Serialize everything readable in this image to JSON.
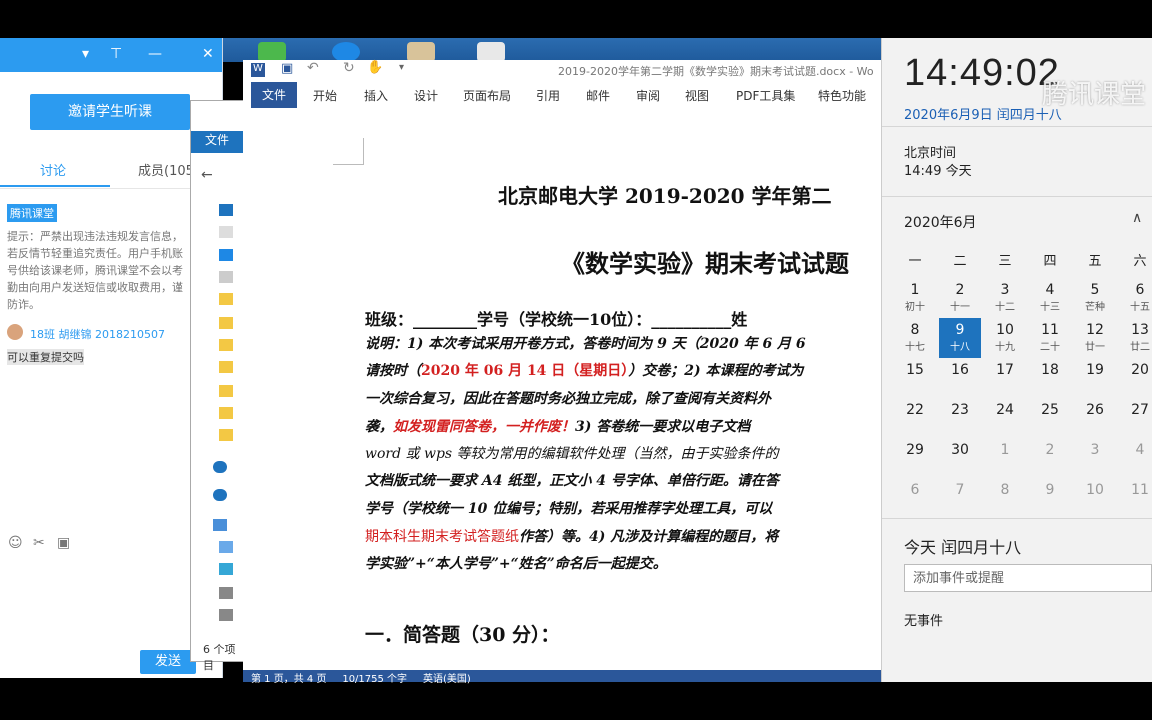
{
  "tencent": {
    "invite_button": "邀请学生听课",
    "tab_discuss": "讨论",
    "tab_members": "成员(105",
    "brand_badge": "腾讯课堂",
    "notice": "提示：严禁出现违法违规发言信息，若反情节轻重追究责任。用户手机账号供给该课老师，腾讯课堂不会以考勤由向用户发送短信或收取费用，谨防诈。",
    "message_user": "18班 胡继锦 2018210507",
    "message_text": "可以重复提交吗",
    "send_button": "发送"
  },
  "explorer": {
    "file_tab": "文件",
    "item_count": "6 个项目"
  },
  "word": {
    "title": "2019-2020学年第二学期《数学实验》期末考试试题.docx - Wo",
    "tabs": [
      "文件",
      "开始",
      "插入",
      "设计",
      "页面布局",
      "引用",
      "邮件",
      "审阅",
      "视图",
      "PDF工具集",
      "特色功能"
    ],
    "status": "第 1 页，共 4 页     10/1755 个字     英语(美国)",
    "doc": {
      "heading1": "北京邮电大学 2019-2020 学年第二",
      "heading2": "《数学实验》期末考试试题",
      "class_line": "班级：________学号（学校统一10位）：__________姓",
      "line1": "说明：1) 本次考试采用开卷方式，答卷时间为 9 天（2020 年 6 月 6",
      "line2a": "请按时（",
      "line2_red": "2020 年 06 月 14 日（星期日）",
      "line2b": "）交卷；2) 本课程的考试为",
      "line3": "一次综合复习，因此在答题时务必独立完成，除了查阅有关资料外",
      "line4a": "袭，",
      "line4_red": "如发现雷同答卷，一并作废！",
      "line4b": "3) 答卷统一要求以电子文档",
      "line5": "word 或 wps 等较为常用的编辑软件处理（当然，由于实验条件的",
      "line6": "文档版式统一要求 A4 纸型，正文小 4 号字体、单倍行距。请在答",
      "line7": "学号（学校统一 10 位编号；特别，若采用推荐字处理工具，可以",
      "line8_red": "期本科生期末考试答题纸",
      "line8b": "作答）等。4) 凡涉及计算编程的题目，将",
      "line9": "学实验”+“本人学号”+“姓名”命名后一起提交。",
      "section1": "一．简答题（30 分）："
    }
  },
  "calendar": {
    "clock": "14:49:02",
    "watermark": "腾讯课堂",
    "date_line": "2020年6月9日 闰四月十八",
    "zone_label": "北京时间",
    "zone_time": "14:49 今天",
    "month": "2020年6月",
    "weekdays": [
      "一",
      "二",
      "三",
      "四",
      "五",
      "六"
    ],
    "rows": [
      [
        [
          "1",
          "初十"
        ],
        [
          "2",
          "十一"
        ],
        [
          "3",
          "十二"
        ],
        [
          "4",
          "十三"
        ],
        [
          "5",
          "芒种"
        ],
        [
          "6",
          "十五"
        ]
      ],
      [
        [
          "8",
          "十七"
        ],
        [
          "9",
          "十八"
        ],
        [
          "10",
          "十九"
        ],
        [
          "11",
          "二十"
        ],
        [
          "12",
          "廿一"
        ],
        [
          "13",
          "廿二"
        ]
      ],
      [
        [
          "15",
          ""
        ],
        [
          "16",
          ""
        ],
        [
          "17",
          ""
        ],
        [
          "18",
          ""
        ],
        [
          "19",
          ""
        ],
        [
          "20",
          ""
        ]
      ],
      [
        [
          "22",
          ""
        ],
        [
          "23",
          ""
        ],
        [
          "24",
          ""
        ],
        [
          "25",
          ""
        ],
        [
          "26",
          ""
        ],
        [
          "27",
          ""
        ]
      ],
      [
        [
          "29",
          ""
        ],
        [
          "30",
          ""
        ],
        [
          "1",
          ""
        ],
        [
          "2",
          ""
        ],
        [
          "3",
          ""
        ],
        [
          "4",
          ""
        ]
      ],
      [
        [
          "6",
          ""
        ],
        [
          "7",
          ""
        ],
        [
          "8",
          ""
        ],
        [
          "9",
          ""
        ],
        [
          "10",
          ""
        ],
        [
          "11",
          ""
        ]
      ]
    ],
    "today_label": "今天 闰四月十八",
    "event_placeholder": "添加事件或提醒",
    "no_events": "无事件"
  }
}
